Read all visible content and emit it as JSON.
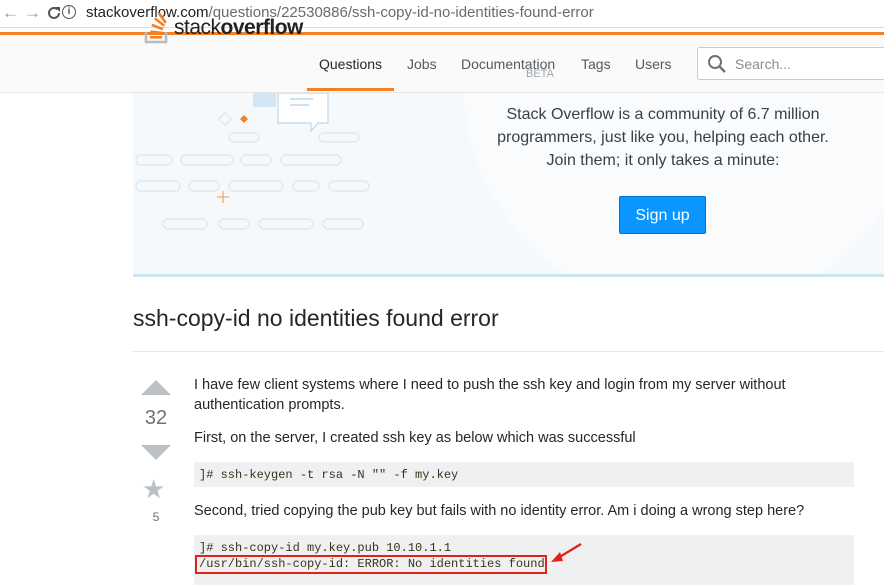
{
  "browser": {
    "back_icon": "arrow-left-icon",
    "forward_icon": "arrow-right-icon",
    "reload_icon": "reload-icon",
    "url_host": "stackoverflow.com",
    "url_path": "/questions/22530886/ssh-copy-id-no-identities-found-error"
  },
  "header": {
    "logo_text_light": "stack",
    "logo_text_bold": "overflow",
    "nav": {
      "questions": "Questions",
      "jobs": "Jobs",
      "documentation": "Documentation",
      "documentation_badge": "BETA",
      "tags": "Tags",
      "users": "Users"
    },
    "search_placeholder": "Search..."
  },
  "hero": {
    "line1": "Stack Overflow is a community of 6.7 million",
    "line2": "programmers, just like you, helping each other.",
    "line3": "Join them; it only takes a minute:",
    "signup_label": "Sign up"
  },
  "question": {
    "title": "ssh-copy-id no identities found error",
    "votes": "32",
    "favorites": "5",
    "p1": "I have few client systems where I need to push the ssh key and login from my server without authentication prompts.",
    "p2": "First, on the server, I created ssh key as below which was successful",
    "code1": "]# ssh-keygen -t rsa -N \"\" -f my.key",
    "p3": "Second, tried copying the pub key but fails with no identity error. Am i doing a wrong step here?",
    "code2_line1": "]# ssh-copy-id my.key.pub 10.10.1.1",
    "code2_line2": "/usr/bin/ssh-copy-id: ERROR: No identities found"
  },
  "colors": {
    "accent": "#f48024",
    "button": "#0a95ff",
    "annotation": "#e0221a"
  }
}
